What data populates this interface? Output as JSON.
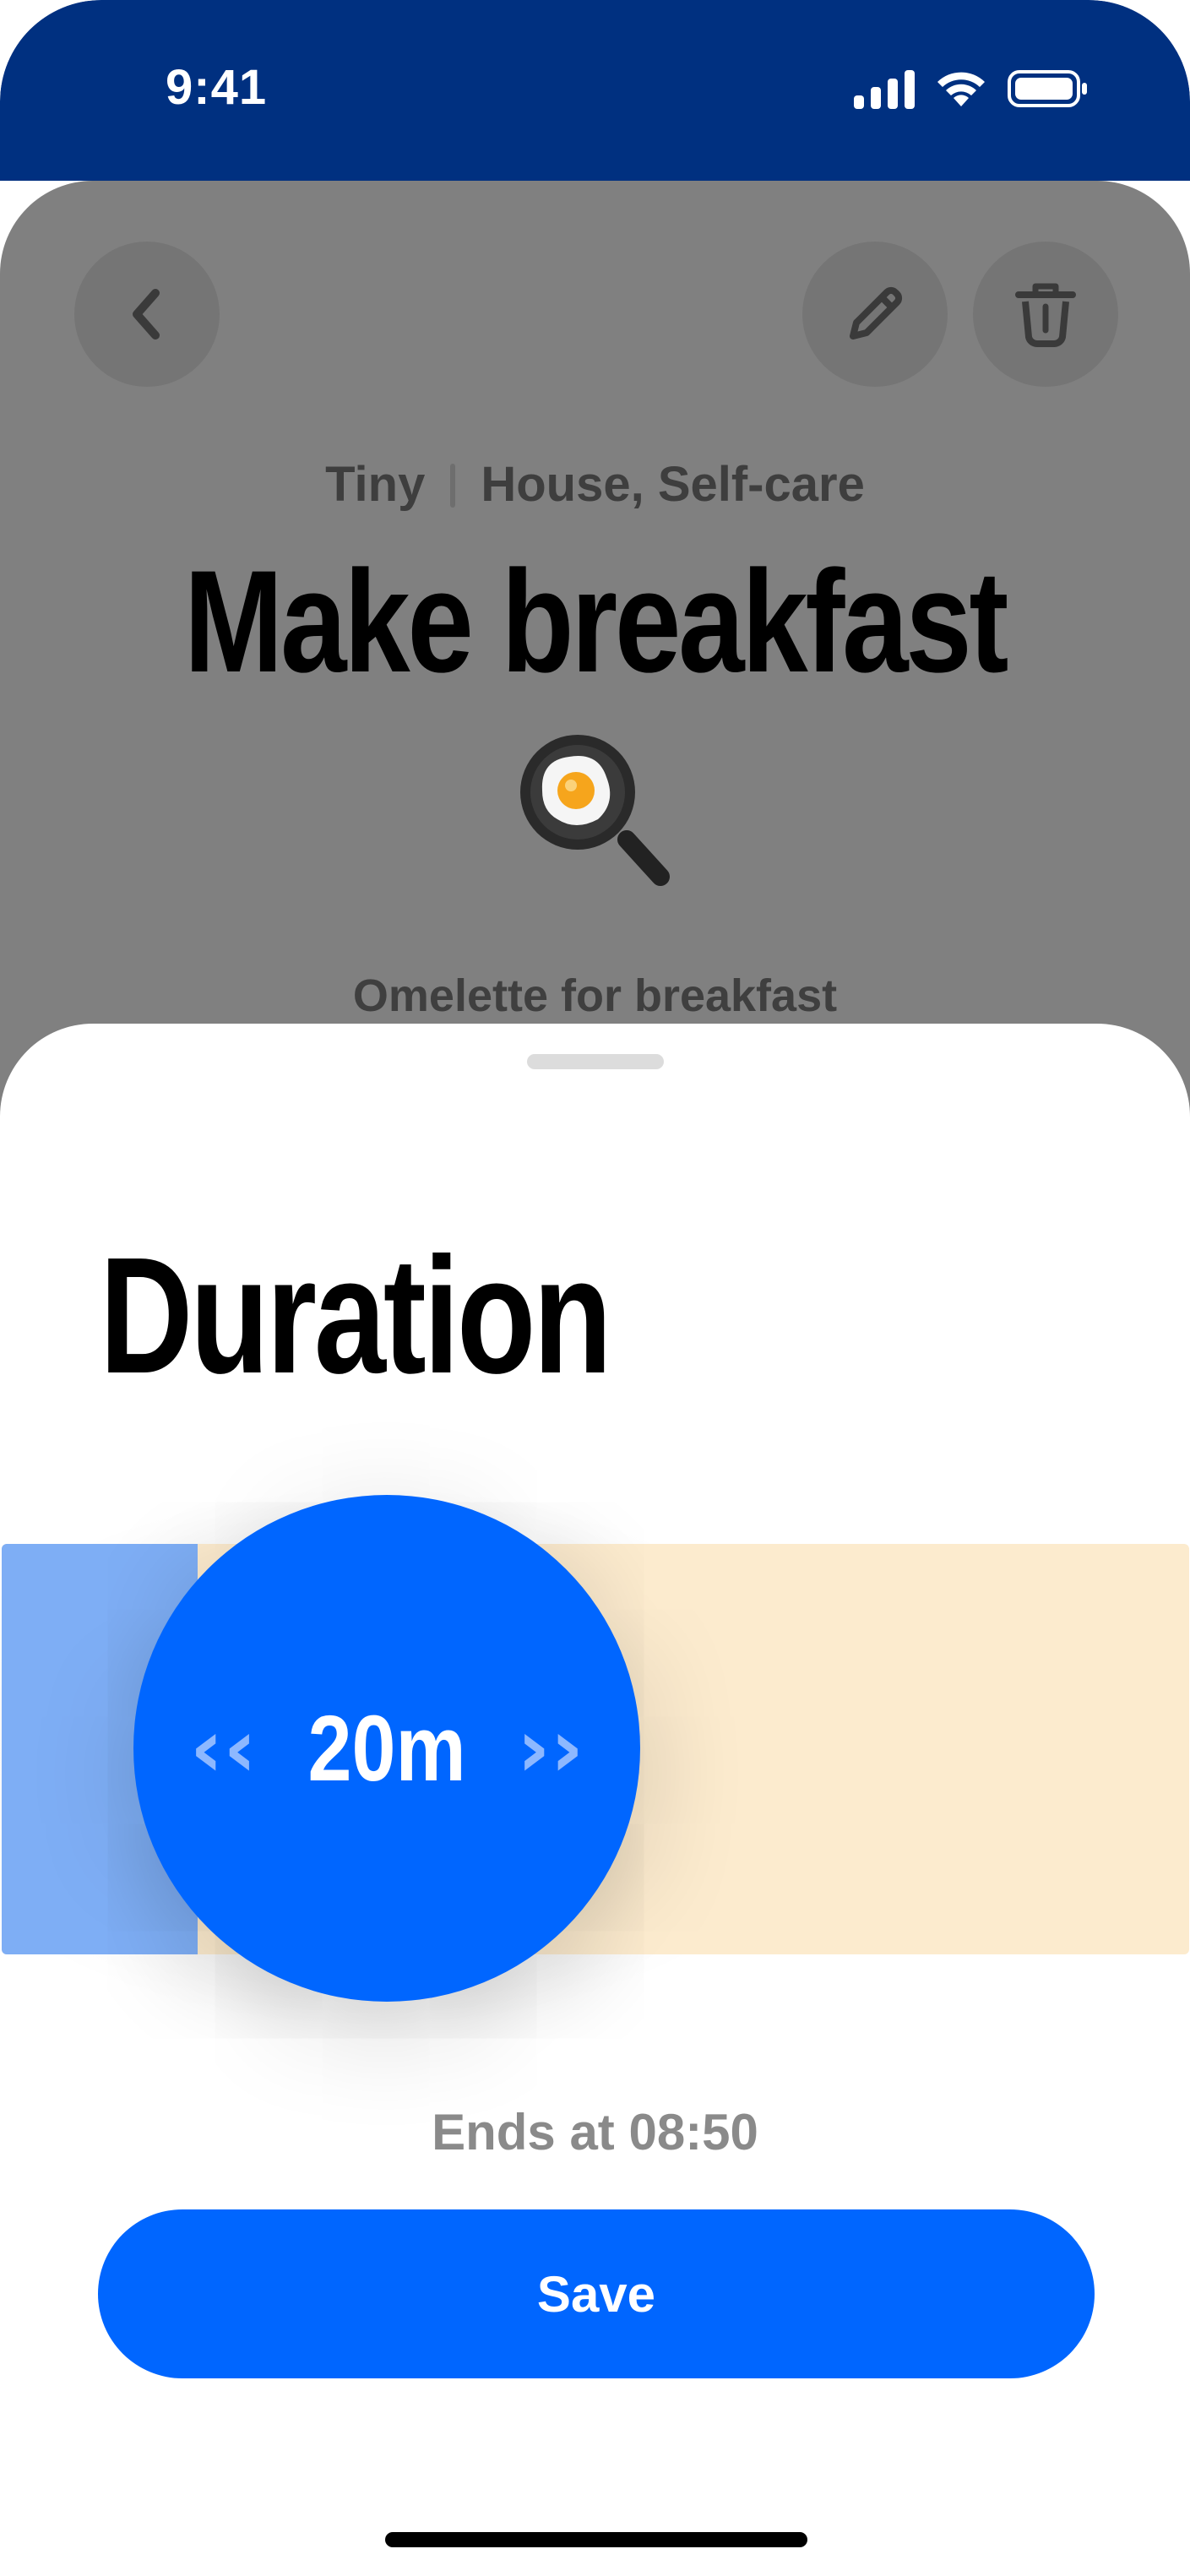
{
  "status_bar": {
    "time": "9:41"
  },
  "header": {
    "back_icon": "chevron-left-icon",
    "edit_icon": "pencil-icon",
    "delete_icon": "trash-icon"
  },
  "task": {
    "size": "Tiny",
    "categories": "House, Self-care",
    "title": "Make breakfast",
    "emoji": "frying-pan-egg-icon",
    "note": "Omelette for breakfast"
  },
  "duration_sheet": {
    "title": "Duration",
    "value": "20m",
    "fill_fraction": 0.165,
    "ends_at": "Ends at 08:50",
    "save_label": "Save"
  },
  "colors": {
    "status_bar": "#003080",
    "accent": "#0066ff",
    "track": "#fcebce",
    "track_fill": "#7eaef5",
    "overlay": "#808080"
  }
}
